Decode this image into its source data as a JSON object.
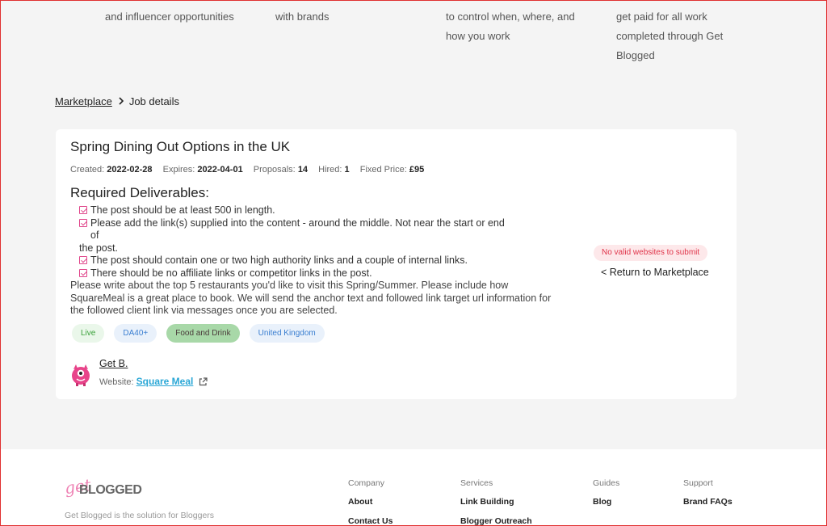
{
  "features": [
    {
      "line1": "and influencer opportunities"
    },
    {
      "line1": "with brands"
    },
    {
      "line1": "to control when, where, and",
      "line2": "how you work"
    },
    {
      "line1": "get paid for all work",
      "line2": "completed through Get",
      "line3": "Blogged"
    }
  ],
  "breadcrumb": {
    "root": "Marketplace",
    "current": "Job details"
  },
  "job": {
    "title": "Spring Dining Out Options in the UK",
    "meta": {
      "created_label": "Created:",
      "created": "2022-02-28",
      "expires_label": "Expires:",
      "expires": "2022-04-01",
      "proposals_label": "Proposals:",
      "proposals": "14",
      "hired_label": "Hired:",
      "hired": "1",
      "price_label": "Fixed Price:",
      "price": "£95"
    },
    "deliverables_heading": "Required Deliverables:",
    "deliverables": [
      "The post should be at least 500 in length.",
      "Please add the link(s) supplied into the content - around the middle. Not near the start or end of",
      "the post.",
      "The post should contain one or two high authority links and a couple of internal links.",
      "There should be no affiliate links or competitor links in the post."
    ],
    "description": "Please write about the top 5 restaurants you'd like to visit this Spring/Summer. Please include how SquareMeal is a great place to book. We will send the anchor text and followed link target url information for the followed client link via messages once you are selected.",
    "tags": [
      "Live",
      "DA40+",
      "Food and Drink",
      "United Kingdom"
    ],
    "author": {
      "name": "Get B.",
      "website_label": "Website:",
      "website": "Square Meal"
    },
    "status_badge": "No valid websites to submit",
    "return_link": "< Return to Marketplace"
  },
  "footer": {
    "logo_get": "get",
    "logo_blogged": "BLOGGED",
    "tagline": "Get Blogged is the solution for Bloggers",
    "columns": [
      {
        "heading": "Company",
        "links": [
          "About",
          "Contact Us"
        ]
      },
      {
        "heading": "Services",
        "links": [
          "Link Building",
          "Blogger Outreach"
        ]
      },
      {
        "heading": "Guides",
        "links": [
          "Blog"
        ]
      },
      {
        "heading": "Support",
        "links": [
          "Brand FAQs"
        ]
      }
    ]
  },
  "colors": {
    "accent_pink": "#e0488c",
    "badge_red": "#e0344a",
    "link_blue": "#2aa7d6"
  }
}
